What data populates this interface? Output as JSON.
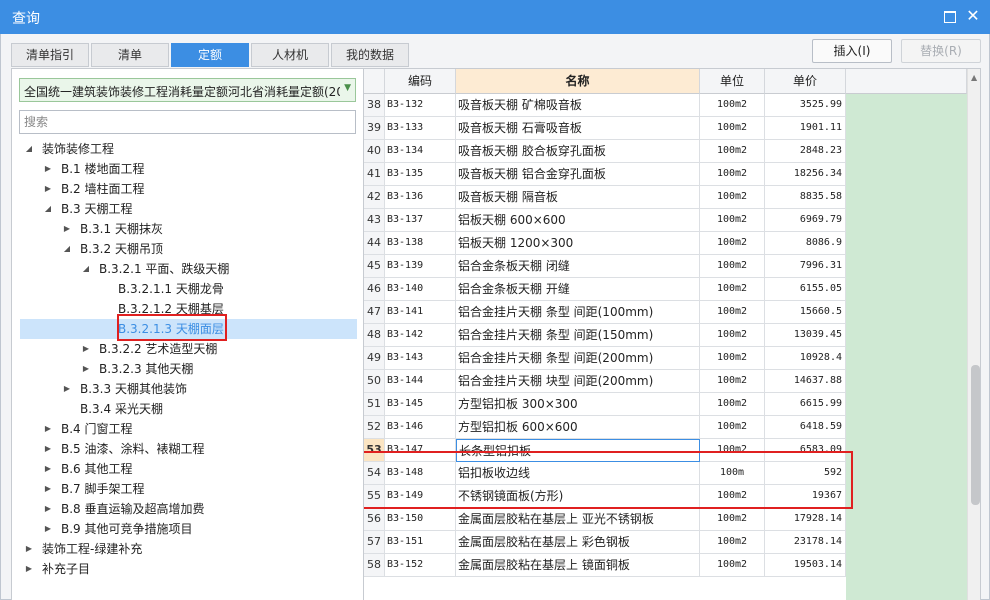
{
  "window": {
    "title": "查询",
    "maximize_icon": "maximize-icon",
    "close_icon": "close-icon",
    "close_glyph": "✕"
  },
  "tabs": [
    {
      "label": "清单指引",
      "active": false
    },
    {
      "label": "清单",
      "active": false
    },
    {
      "label": "定额",
      "active": true
    },
    {
      "label": "人材机",
      "active": false
    },
    {
      "label": "我的数据",
      "active": false
    }
  ],
  "actions": {
    "insert_label": "插入(I)",
    "replace_label": "替换(R)"
  },
  "library": {
    "selected": "全国统一建筑装饰装修工程消耗量定额河北省消耗量定额(20",
    "dropdown_icon": "chevron-down-icon"
  },
  "search": {
    "placeholder": "搜索",
    "value": ""
  },
  "tree": [
    {
      "label": "装饰装修工程",
      "expanded": true
    },
    {
      "label": "B.1 楼地面工程",
      "expanded": false
    },
    {
      "label": "B.2 墙柱面工程",
      "expanded": false
    },
    {
      "label": "B.3 天棚工程",
      "expanded": true
    },
    {
      "label": "B.3.1 天棚抹灰",
      "expanded": false
    },
    {
      "label": "B.3.2 天棚吊顶",
      "expanded": true
    },
    {
      "label": "B.3.2.1 平面、跌级天棚",
      "expanded": true
    },
    {
      "label": "B.3.2.1.1 天棚龙骨"
    },
    {
      "label": "B.3.2.1.2 天棚基层"
    },
    {
      "label": "B.3.2.1.3 天棚面层",
      "selected": true
    },
    {
      "label": "B.3.2.2 艺术造型天棚",
      "expanded": false
    },
    {
      "label": "B.3.2.3 其他天棚",
      "expanded": false
    },
    {
      "label": "B.3.3 天棚其他装饰",
      "expanded": false
    },
    {
      "label": "B.3.4 采光天棚"
    },
    {
      "label": "B.4 门窗工程",
      "expanded": false
    },
    {
      "label": "B.5 油漆、涂料、裱糊工程",
      "expanded": false
    },
    {
      "label": "B.6 其他工程",
      "expanded": false
    },
    {
      "label": "B.7 脚手架工程",
      "expanded": false
    },
    {
      "label": "B.8 垂直运输及超高增加费",
      "expanded": false
    },
    {
      "label": "B.9 其他可竞争措施项目",
      "expanded": false
    },
    {
      "label": "装饰工程-绿建补充",
      "expanded": false
    },
    {
      "label": "补充子目",
      "expanded": false
    }
  ],
  "grid": {
    "columns": [
      "",
      "编码",
      "名称",
      "单位",
      "单价"
    ],
    "current_row": "53",
    "rows": [
      {
        "no": "38",
        "code": "B3-132",
        "name": "吸音板天棚 矿棉吸音板",
        "unit": "100m2",
        "price": "3525.99"
      },
      {
        "no": "39",
        "code": "B3-133",
        "name": "吸音板天棚 石膏吸音板",
        "unit": "100m2",
        "price": "1901.11"
      },
      {
        "no": "40",
        "code": "B3-134",
        "name": "吸音板天棚 胶合板穿孔面板",
        "unit": "100m2",
        "price": "2848.23"
      },
      {
        "no": "41",
        "code": "B3-135",
        "name": "吸音板天棚 铝合金穿孔面板",
        "unit": "100m2",
        "price": "18256.34"
      },
      {
        "no": "42",
        "code": "B3-136",
        "name": "吸音板天棚 隔音板",
        "unit": "100m2",
        "price": "8835.58"
      },
      {
        "no": "43",
        "code": "B3-137",
        "name": "铝板天棚 600×600",
        "unit": "100m2",
        "price": "6969.79"
      },
      {
        "no": "44",
        "code": "B3-138",
        "name": "铝板天棚 1200×300",
        "unit": "100m2",
        "price": "8086.9"
      },
      {
        "no": "45",
        "code": "B3-139",
        "name": "铝合金条板天棚 闭缝",
        "unit": "100m2",
        "price": "7996.31"
      },
      {
        "no": "46",
        "code": "B3-140",
        "name": "铝合金条板天棚 开缝",
        "unit": "100m2",
        "price": "6155.05"
      },
      {
        "no": "47",
        "code": "B3-141",
        "name": "铝合金挂片天棚 条型 间距(100mm)",
        "unit": "100m2",
        "price": "15660.5"
      },
      {
        "no": "48",
        "code": "B3-142",
        "name": "铝合金挂片天棚 条型 间距(150mm)",
        "unit": "100m2",
        "price": "13039.45"
      },
      {
        "no": "49",
        "code": "B3-143",
        "name": "铝合金挂片天棚 条型 间距(200mm)",
        "unit": "100m2",
        "price": "10928.4"
      },
      {
        "no": "50",
        "code": "B3-144",
        "name": "铝合金挂片天棚 块型 间距(200mm)",
        "unit": "100m2",
        "price": "14637.88"
      },
      {
        "no": "51",
        "code": "B3-145",
        "name": "方型铝扣板 300×300",
        "unit": "100m2",
        "price": "6615.99"
      },
      {
        "no": "52",
        "code": "B3-146",
        "name": "方型铝扣板 600×600",
        "unit": "100m2",
        "price": "6418.59"
      },
      {
        "no": "53",
        "code": "B3-147",
        "name": "长条型铝扣板",
        "unit": "100m2",
        "price": "6583.09"
      },
      {
        "no": "54",
        "code": "B3-148",
        "name": "铝扣板收边线",
        "unit": "100m",
        "price": "592"
      },
      {
        "no": "55",
        "code": "B3-149",
        "name": "不锈钢镜面板(方形)",
        "unit": "100m2",
        "price": "19367"
      },
      {
        "no": "56",
        "code": "B3-150",
        "name": "金属面层胶粘在基层上 亚光不锈钢板",
        "unit": "100m2",
        "price": "17928.14"
      },
      {
        "no": "57",
        "code": "B3-151",
        "name": "金属面层胶粘在基层上 彩色钢板",
        "unit": "100m2",
        "price": "23178.14"
      },
      {
        "no": "58",
        "code": "B3-152",
        "name": "金属面层胶粘在基层上 镜面铜板",
        "unit": "100m2",
        "price": "19503.14"
      }
    ]
  },
  "colors": {
    "accent": "#3c8ee3",
    "highlight_border": "#e02020",
    "green_column": "#cfe9d3"
  }
}
